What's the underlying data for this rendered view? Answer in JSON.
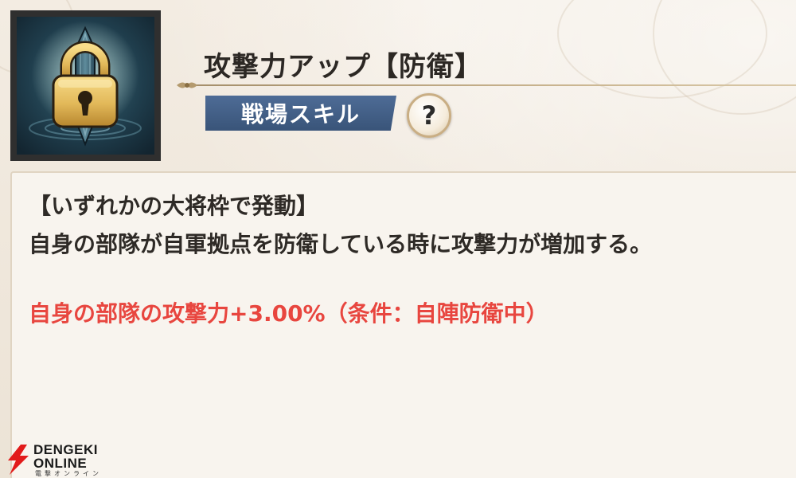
{
  "skill": {
    "title": "攻撃力アップ【防衛】",
    "category": "戦場スキル",
    "help_label": "?"
  },
  "description": {
    "condition": "【いずれかの大将枠で発動】",
    "effect": "自身の部隊が自軍拠点を防衛している時に攻撃力が増加する。",
    "value": "自身の部隊の攻撃力+3.00%（条件：自陣防衛中）"
  },
  "watermark": {
    "line1": "DENGEKI",
    "line2": "ONLINE",
    "sub": "電撃オンライン"
  },
  "colors": {
    "accent_red": "#e8463f",
    "badge_blue": "#395479",
    "lock_gold": "#e2b859"
  },
  "icons": {
    "skill": "padlock-sword-icon",
    "help": "question-mark-icon",
    "logo": "lightning-bolt-logo"
  }
}
